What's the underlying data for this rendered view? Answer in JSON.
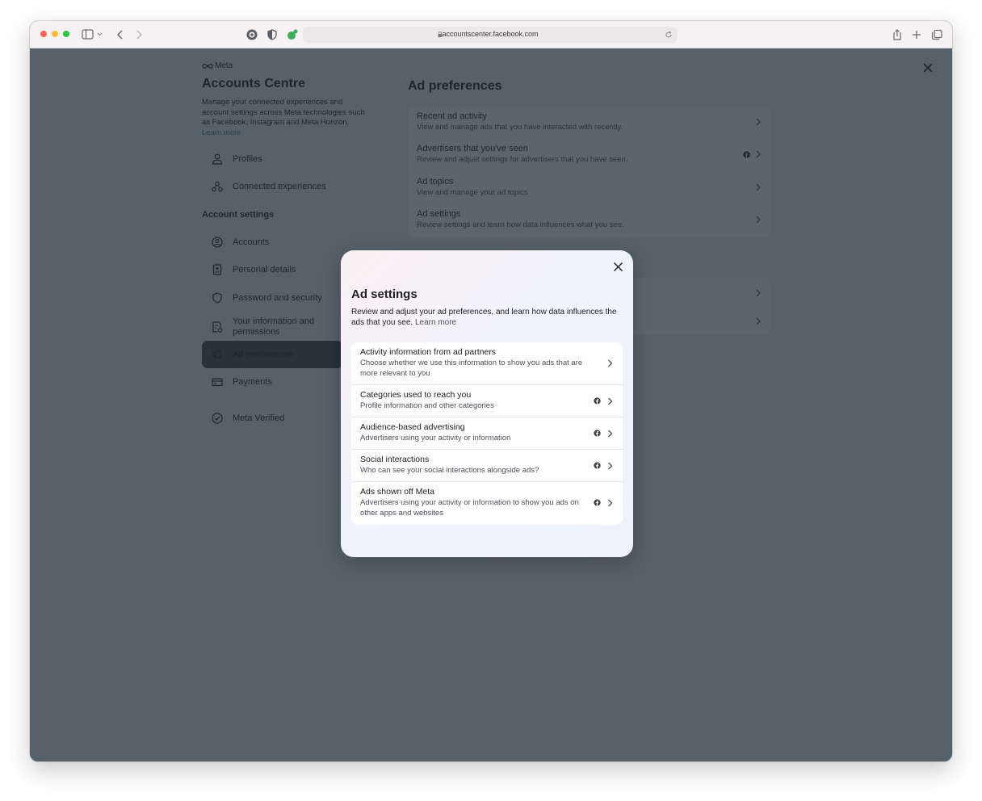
{
  "browser": {
    "url": "accountscenter.facebook.com",
    "traffic_lights": [
      "#ff5f57",
      "#febc2e",
      "#28c840"
    ]
  },
  "sidebar": {
    "brand": "Meta",
    "title": "Accounts Centre",
    "description": "Manage your connected experiences and account settings across Meta technologies such as Facebook, Instagram and Meta Horizon.",
    "learn_more": "Learn more",
    "top_items": [
      {
        "label": "Profiles",
        "icon": "person-icon"
      },
      {
        "label": "Connected experiences",
        "icon": "connected-icon"
      }
    ],
    "section_heading": "Account settings",
    "items": [
      {
        "label": "Accounts",
        "icon": "account-circle-icon"
      },
      {
        "label": "Personal details",
        "icon": "id-card-icon"
      },
      {
        "label": "Password and security",
        "icon": "shield-icon"
      },
      {
        "label": "Your information and permissions",
        "icon": "info-doc-icon"
      },
      {
        "label": "Ad preferences",
        "icon": "megaphone-icon",
        "active": true
      },
      {
        "label": "Payments",
        "icon": "card-icon"
      }
    ],
    "bottom_item": {
      "label": "Meta Verified",
      "icon": "verified-badge-icon"
    }
  },
  "main": {
    "title": "Ad preferences",
    "rows": [
      {
        "title": "Recent ad activity",
        "subtitle": "View and manage ads that you have interacted with recently."
      },
      {
        "title": "Advertisers that you've seen",
        "subtitle": "Review and adjust settings for advertisers that you have seen.",
        "facebook_icon": true
      },
      {
        "title": "Ad topics",
        "subtitle": "View and manage your ad topics"
      },
      {
        "title": "Ad settings",
        "subtitle": "Review settings and learn how data influences what you see."
      }
    ]
  },
  "modal": {
    "title": "Ad settings",
    "description": "Review and adjust your ad preferences, and learn how data influences the ads that you see.",
    "learn_more": "Learn more",
    "rows": [
      {
        "title": "Activity information from ad partners",
        "subtitle": "Choose whether we use this information to show you ads that are more relevant to you",
        "facebook_icon": false
      },
      {
        "title": "Categories used to reach you",
        "subtitle": "Profile information and other categories",
        "facebook_icon": true
      },
      {
        "title": "Audience-based advertising",
        "subtitle": "Advertisers using your activity or information",
        "facebook_icon": true
      },
      {
        "title": "Social interactions",
        "subtitle": "Who can see your social interactions alongside ads?",
        "facebook_icon": true
      },
      {
        "title": "Ads shown off Meta",
        "subtitle": "Advertisers using your activity or information to show you ads on other apps and websites",
        "facebook_icon": true
      }
    ]
  }
}
